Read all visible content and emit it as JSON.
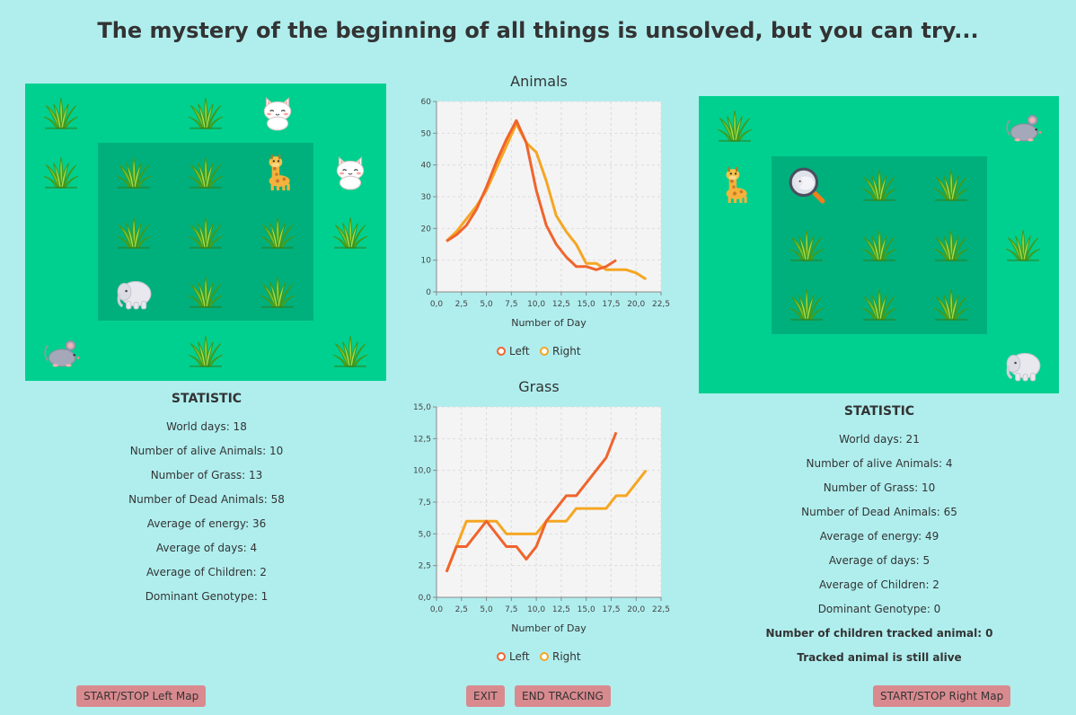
{
  "title": "The mystery of the beginning of all things is unsolved, but you can try...",
  "left_map": {
    "cells": [
      {
        "c": 0,
        "r": 0,
        "t": "grass"
      },
      {
        "c": 2,
        "r": 0,
        "t": "grass"
      },
      {
        "c": 3,
        "r": 0,
        "t": "cat"
      },
      {
        "c": 0,
        "r": 1,
        "t": "grass"
      },
      {
        "c": 1,
        "r": 1,
        "t": "grass"
      },
      {
        "c": 2,
        "r": 1,
        "t": "grass"
      },
      {
        "c": 3,
        "r": 1,
        "t": "giraffe"
      },
      {
        "c": 4,
        "r": 1,
        "t": "cat"
      },
      {
        "c": 1,
        "r": 2,
        "t": "grass"
      },
      {
        "c": 2,
        "r": 2,
        "t": "grass"
      },
      {
        "c": 3,
        "r": 2,
        "t": "grass"
      },
      {
        "c": 4,
        "r": 2,
        "t": "grass"
      },
      {
        "c": 1,
        "r": 3,
        "t": "elephant"
      },
      {
        "c": 2,
        "r": 3,
        "t": "grass"
      },
      {
        "c": 3,
        "r": 3,
        "t": "grass"
      },
      {
        "c": 0,
        "r": 4,
        "t": "mouse"
      },
      {
        "c": 2,
        "r": 4,
        "t": "grass"
      },
      {
        "c": 4,
        "r": 4,
        "t": "grass"
      }
    ],
    "stats": {
      "title": "STATISTIC",
      "rows": [
        "World days: 18",
        "Number of alive Animals: 10",
        "Number of Grass: 13",
        "Number of Dead Animals: 58",
        "Average of energy: 36",
        "Average of days: 4",
        "Average of Children: 2",
        "Dominant Genotype:  1"
      ]
    }
  },
  "right_map": {
    "cells": [
      {
        "c": 4,
        "r": 0,
        "t": "mouse"
      },
      {
        "c": 0,
        "r": 0,
        "t": "grass"
      },
      {
        "c": 0,
        "r": 1,
        "t": "giraffe"
      },
      {
        "c": 1,
        "r": 1,
        "t": "elephant_tracked"
      },
      {
        "c": 2,
        "r": 1,
        "t": "grass"
      },
      {
        "c": 3,
        "r": 1,
        "t": "grass"
      },
      {
        "c": 1,
        "r": 2,
        "t": "grass"
      },
      {
        "c": 2,
        "r": 2,
        "t": "grass"
      },
      {
        "c": 3,
        "r": 2,
        "t": "grass"
      },
      {
        "c": 4,
        "r": 2,
        "t": "grass"
      },
      {
        "c": 1,
        "r": 3,
        "t": "grass"
      },
      {
        "c": 2,
        "r": 3,
        "t": "grass"
      },
      {
        "c": 3,
        "r": 3,
        "t": "grass"
      },
      {
        "c": 4,
        "r": 4,
        "t": "elephant"
      }
    ],
    "stats": {
      "title": "STATISTIC",
      "rows": [
        "World days: 21",
        "Number of alive Animals: 4",
        "Number of Grass: 10",
        "Number of Dead Animals: 65",
        "Average of energy: 49",
        "Average of days: 5",
        "Average of Children: 2",
        "Dominant Genotype:  0"
      ],
      "bold_rows": [
        "Number of children tracked animal: 0",
        "Tracked animal is still alive"
      ]
    }
  },
  "buttons": {
    "left": "START/STOP Left Map",
    "exit": "EXIT",
    "end_tracking": "END TRACKING",
    "right": "START/STOP Right Map"
  },
  "colors": {
    "background": "#b0eeee",
    "map": "#00d08f",
    "jungle": "#00b07c",
    "left_series": "#f0642d",
    "right_series": "#f5a623",
    "button": "#d98a8f"
  },
  "chart_data": [
    {
      "type": "line",
      "title": "Animals",
      "xlabel": "Number of Day",
      "ylabel": "",
      "xlim": [
        0,
        22.5
      ],
      "ylim": [
        0,
        60
      ],
      "xticks": [
        "0,0",
        "2,5",
        "5,0",
        "7,5",
        "10,0",
        "12,5",
        "15,0",
        "17,5",
        "20,0",
        "22,5"
      ],
      "yticks": [
        "0",
        "10",
        "20",
        "30",
        "40",
        "50",
        "60"
      ],
      "grid": true,
      "legend": "bottom",
      "series": [
        {
          "name": "Left",
          "x": [
            1,
            2,
            3,
            4,
            5,
            6,
            7,
            8,
            9,
            10,
            11,
            12,
            13,
            14,
            15,
            16,
            17,
            18
          ],
          "y": [
            16,
            18,
            21,
            26,
            33,
            41,
            48,
            54,
            47,
            32,
            21,
            15,
            11,
            8,
            8,
            7,
            8,
            10
          ]
        },
        {
          "name": "Right",
          "x": [
            1,
            2,
            3,
            4,
            5,
            6,
            7,
            8,
            9,
            10,
            11,
            12,
            13,
            14,
            15,
            16,
            17,
            18,
            19,
            20,
            21
          ],
          "y": [
            16,
            19,
            23,
            27,
            32,
            39,
            46,
            53,
            47,
            44,
            35,
            24,
            19,
            15,
            9,
            9,
            7,
            7,
            7,
            6,
            4
          ]
        }
      ]
    },
    {
      "type": "line",
      "title": "Grass",
      "xlabel": "Number of Day",
      "ylabel": "",
      "xlim": [
        0,
        22.5
      ],
      "ylim": [
        0,
        15
      ],
      "xticks": [
        "0,0",
        "2,5",
        "5,0",
        "7,5",
        "10,0",
        "12,5",
        "15,0",
        "17,5",
        "20,0",
        "22,5"
      ],
      "yticks": [
        "0,0",
        "2,5",
        "5,0",
        "7,5",
        "10,0",
        "12,5",
        "15,0"
      ],
      "grid": true,
      "legend": "bottom",
      "series": [
        {
          "name": "Left",
          "x": [
            1,
            2,
            3,
            4,
            5,
            6,
            7,
            8,
            9,
            10,
            11,
            12,
            13,
            14,
            15,
            16,
            17,
            18
          ],
          "y": [
            2,
            4,
            4,
            5,
            6,
            5,
            4,
            4,
            3,
            4,
            6,
            7,
            8,
            8,
            9,
            10,
            11,
            13
          ]
        },
        {
          "name": "Right",
          "x": [
            1,
            2,
            3,
            4,
            5,
            6,
            7,
            8,
            9,
            10,
            11,
            12,
            13,
            14,
            15,
            16,
            17,
            18,
            19,
            20,
            21
          ],
          "y": [
            2,
            4,
            6,
            6,
            6,
            6,
            5,
            5,
            5,
            5,
            6,
            6,
            6,
            7,
            7,
            7,
            7,
            8,
            8,
            9,
            10
          ]
        }
      ]
    }
  ]
}
